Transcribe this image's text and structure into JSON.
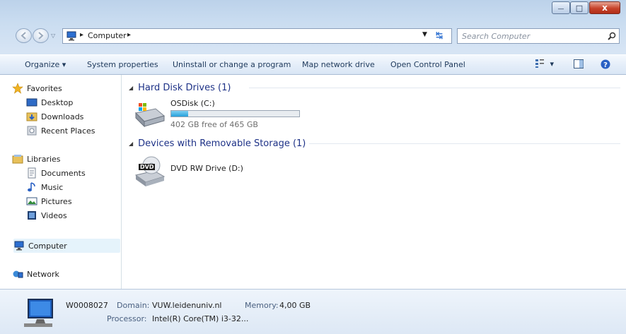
{
  "window": {
    "minimize_glyph": "—",
    "maximize_glyph": "□",
    "close_glyph": "x"
  },
  "address": {
    "path": [
      "Computer"
    ],
    "separator": "▸",
    "search_placeholder": "Search Computer"
  },
  "toolbar": {
    "organize": "Organize",
    "system_properties": "System properties",
    "uninstall": "Uninstall or change a program",
    "map_drive": "Map network drive",
    "control_panel": "Open Control Panel",
    "dropdown_glyph": "▾"
  },
  "sidebar": {
    "favorites": "Favorites",
    "desktop": "Desktop",
    "downloads": "Downloads",
    "recent": "Recent Places",
    "libraries": "Libraries",
    "documents": "Documents",
    "music": "Music",
    "pictures": "Pictures",
    "videos": "Videos",
    "computer": "Computer",
    "network": "Network"
  },
  "groups": {
    "hdd": {
      "title": "Hard Disk Drives (1)",
      "drive_name": "OSDisk (C:)",
      "free_text": "402 GB free of 465 GB",
      "used_fraction": 0.135
    },
    "removable": {
      "title": "Devices with Removable Storage (1)",
      "drive_name": "DVD RW Drive (D:)",
      "dvd_badge": "DVD"
    }
  },
  "status": {
    "computer_name": "W0008027",
    "domain_label": "Domain:",
    "domain_value": "VUW.leidenuniv.nl",
    "memory_label": "Memory:",
    "memory_value": "4,00 GB",
    "processor_label": "Processor:",
    "processor_value": "Intel(R) Core(TM) i3-32..."
  },
  "colors": {
    "accent": "#1e3287",
    "progress_fill": "#26a0da",
    "selection": "#e5f3fb"
  }
}
